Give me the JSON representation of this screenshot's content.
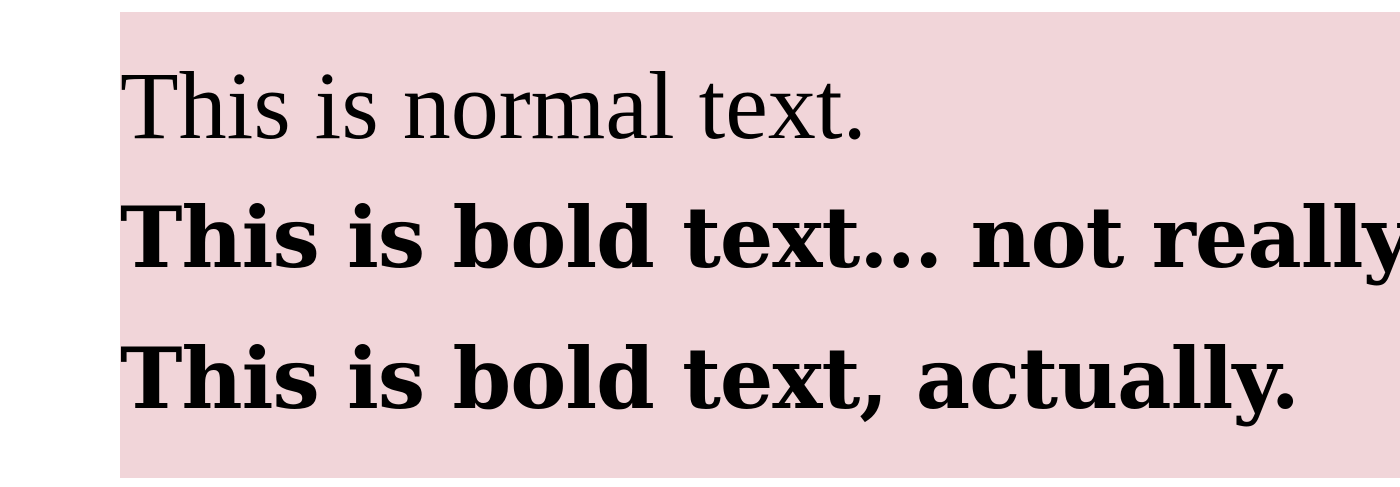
{
  "colors": {
    "panel_background": "#f1d5d9",
    "page_background": "#ffffff",
    "text": "#000000"
  },
  "lines": [
    {
      "text": "This is normal text.",
      "weight": "normal"
    },
    {
      "text": "This is bold text… not really.",
      "weight": "bold"
    },
    {
      "text": "This is bold text, actually.",
      "weight": "bold"
    }
  ]
}
